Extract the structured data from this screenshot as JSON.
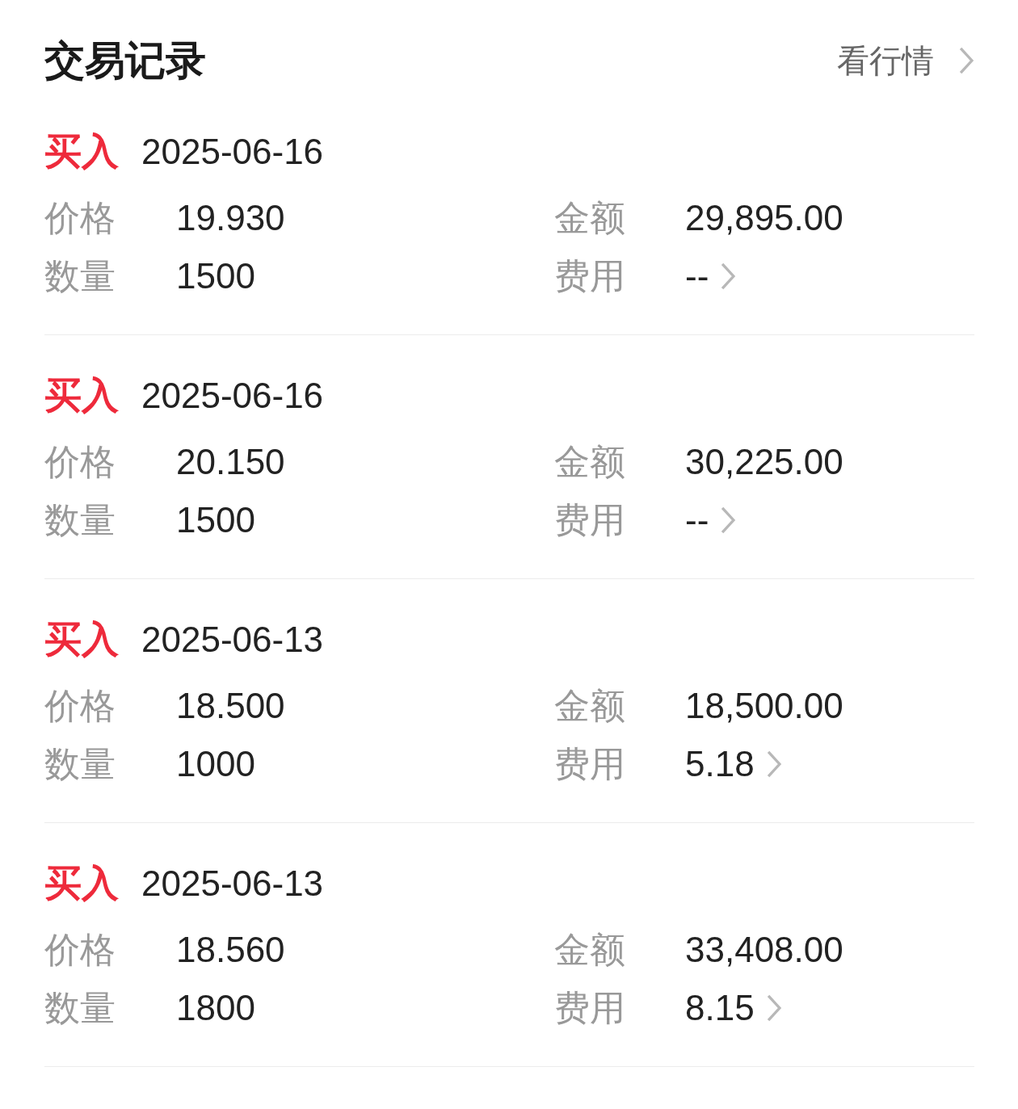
{
  "header": {
    "title": "交易记录",
    "link": "看行情"
  },
  "records": [
    {
      "side": "买入",
      "kind": "buy",
      "date": "2025-06-16",
      "price_label": "价格",
      "price": "19.930",
      "amount_label": "金额",
      "amount": "29,895.00",
      "qty_label": "数量",
      "qty": "1500",
      "fee_label": "费用",
      "fee": "--"
    },
    {
      "side": "买入",
      "kind": "buy",
      "date": "2025-06-16",
      "price_label": "价格",
      "price": "20.150",
      "amount_label": "金额",
      "amount": "30,225.00",
      "qty_label": "数量",
      "qty": "1500",
      "fee_label": "费用",
      "fee": "--"
    },
    {
      "side": "买入",
      "kind": "buy",
      "date": "2025-06-13",
      "price_label": "价格",
      "price": "18.500",
      "amount_label": "金额",
      "amount": "18,500.00",
      "qty_label": "数量",
      "qty": "1000",
      "fee_label": "费用",
      "fee": "5.18"
    },
    {
      "side": "买入",
      "kind": "buy",
      "date": "2025-06-13",
      "price_label": "价格",
      "price": "18.560",
      "amount_label": "金额",
      "amount": "33,408.00",
      "qty_label": "数量",
      "qty": "1800",
      "fee_label": "费用",
      "fee": "8.15"
    }
  ]
}
